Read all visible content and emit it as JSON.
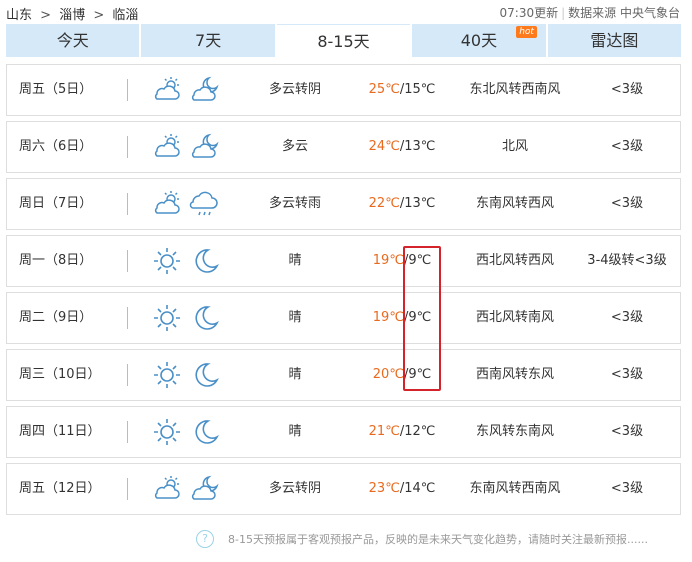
{
  "breadcrumb": [
    "山东",
    "淄博",
    "临淄"
  ],
  "breadcrumb_sep": ">",
  "meta": {
    "updated": "07:30更新",
    "source_label": "数据来源",
    "source": "中央气象台"
  },
  "tabs": [
    {
      "label": "今天"
    },
    {
      "label": "7天"
    },
    {
      "label": "8-15天",
      "active": true
    },
    {
      "label": "40天",
      "badge": "hot"
    },
    {
      "label": "雷达图"
    }
  ],
  "days": [
    {
      "day": "周五（5日）",
      "icon_day": "partly-cloudy-icon",
      "icon_night": "cloudy-night-icon",
      "cond": "多云转阴",
      "hi": "25℃",
      "lo": "/15℃",
      "wind": "东北风转西南风",
      "level": "<3级"
    },
    {
      "day": "周六（6日）",
      "icon_day": "partly-cloudy-icon",
      "icon_night": "cloudy-night-icon",
      "cond": "多云",
      "hi": "24℃",
      "lo": "/13℃",
      "wind": "北风",
      "level": "<3级"
    },
    {
      "day": "周日（7日）",
      "icon_day": "partly-cloudy-icon",
      "icon_night": "rain-icon",
      "cond": "多云转雨",
      "hi": "22℃",
      "lo": "/13℃",
      "wind": "东南风转西风",
      "level": "<3级"
    },
    {
      "day": "周一（8日）",
      "icon_day": "sun-icon",
      "icon_night": "moon-icon",
      "cond": "晴",
      "hi": "19℃",
      "lo": "/9℃",
      "wind": "西北风转西风",
      "level": "3-4级转<3级"
    },
    {
      "day": "周二（9日）",
      "icon_day": "sun-icon",
      "icon_night": "moon-icon",
      "cond": "晴",
      "hi": "19℃",
      "lo": "/9℃",
      "wind": "西北风转南风",
      "level": "<3级"
    },
    {
      "day": "周三（10日）",
      "icon_day": "sun-icon",
      "icon_night": "moon-icon",
      "cond": "晴",
      "hi": "20℃",
      "lo": "/9℃",
      "wind": "西南风转东风",
      "level": "<3级"
    },
    {
      "day": "周四（11日）",
      "icon_day": "sun-icon",
      "icon_night": "moon-icon",
      "cond": "晴",
      "hi": "21℃",
      "lo": "/12℃",
      "wind": "东风转东南风",
      "level": "<3级"
    },
    {
      "day": "周五（12日）",
      "icon_day": "partly-cloudy-icon",
      "icon_night": "cloudy-night-icon",
      "cond": "多云转阴",
      "hi": "23℃",
      "lo": "/14℃",
      "wind": "东南风转西南风",
      "level": "<3级"
    }
  ],
  "footer": {
    "note": "8-15天预报属于客观预报产品，反映的是未来天气变化趋势，请随时关注最新预报......"
  },
  "colors": {
    "tab_bg": "#d6e9f8",
    "high_temp": "#e86a1e",
    "icon": "#4a90c8",
    "highlight": "#d4232a"
  }
}
